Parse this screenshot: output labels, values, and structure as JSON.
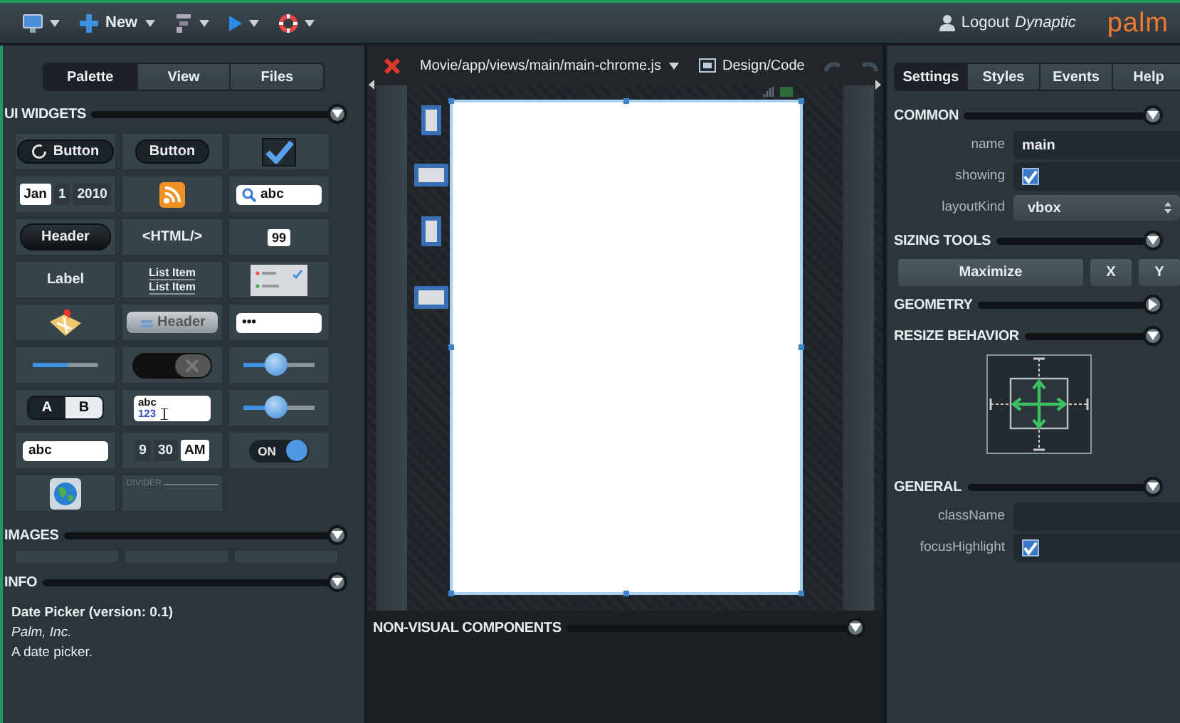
{
  "toolbar": {
    "items": [
      {
        "kind": "monitor"
      },
      {
        "kind": "new",
        "label": "New"
      },
      {
        "kind": "tools"
      },
      {
        "kind": "run"
      },
      {
        "kind": "lifebuoy"
      }
    ],
    "logout": {
      "label": "Logout",
      "user": "Dynaptic"
    },
    "logo": "palm"
  },
  "left_panel": {
    "tabs": [
      {
        "label": "Palette",
        "selected": true
      },
      {
        "label": "View",
        "selected": false
      },
      {
        "label": "Files",
        "selected": false
      }
    ],
    "widgets_section": {
      "title": "UI WIDGETS",
      "expanded": true
    },
    "widgets": [
      {
        "kind": "spinner-button",
        "label": "Button"
      },
      {
        "kind": "button",
        "label": "Button"
      },
      {
        "kind": "checkbox",
        "checked": true
      },
      {
        "kind": "date",
        "parts": [
          {
            "label": "Jan",
            "selected": true
          },
          {
            "label": "1",
            "selected": false
          },
          {
            "label": "2010",
            "selected": false
          }
        ]
      },
      {
        "kind": "feed"
      },
      {
        "kind": "search",
        "value": "abc"
      },
      {
        "kind": "header-button",
        "label": "Header"
      },
      {
        "kind": "text",
        "label": "<HTML/>"
      },
      {
        "kind": "number",
        "value": "99"
      },
      {
        "kind": "text",
        "label": "Label"
      },
      {
        "kind": "list",
        "items": [
          "List Item",
          "List Item"
        ]
      },
      {
        "kind": "menu-preview"
      },
      {
        "kind": "map"
      },
      {
        "kind": "toolbar-header",
        "label": "Header"
      },
      {
        "kind": "password",
        "value": "•••"
      },
      {
        "kind": "progress",
        "level": 0.55
      },
      {
        "kind": "delete-toggle"
      },
      {
        "kind": "slider",
        "level": 0.45
      },
      {
        "kind": "segmented",
        "options": [
          {
            "label": "A",
            "selected": true
          },
          {
            "label": "B",
            "selected": false
          }
        ]
      },
      {
        "kind": "rich-text",
        "lines": [
          "abc",
          "123"
        ]
      },
      {
        "kind": "slider",
        "level": 0.45
      },
      {
        "kind": "input",
        "value": "abc"
      },
      {
        "kind": "time",
        "parts": [
          {
            "label": "9",
            "selected": false
          },
          {
            "label": "30",
            "selected": false
          },
          {
            "label": "AM",
            "selected": true
          }
        ]
      },
      {
        "kind": "switch",
        "label": "ON",
        "on": true
      },
      {
        "kind": "globe"
      },
      {
        "kind": "divider",
        "label": "DIVIDER"
      }
    ],
    "images_section": {
      "title": "IMAGES",
      "expanded": true
    },
    "info_section": {
      "title": "INFO",
      "expanded": true
    },
    "info": {
      "title": "Date Picker (version: 0.1)",
      "vendor": "Palm, Inc.",
      "description": "A date picker."
    }
  },
  "editor": {
    "file": "Movie/app/views/main/main-chrome.js",
    "mode": "Design/Code",
    "nonvisual_section": {
      "title": "NON-VISUAL COMPONENTS",
      "expanded": true
    }
  },
  "inspector": {
    "tabs": [
      {
        "label": "Settings",
        "selected": true
      },
      {
        "label": "Styles",
        "selected": false
      },
      {
        "label": "Events",
        "selected": false
      },
      {
        "label": "Help",
        "selected": false
      }
    ],
    "sections": [
      {
        "kind": "properties",
        "title": "COMMON",
        "expanded": true,
        "fields": [
          {
            "kind": "text",
            "label": "name",
            "value": "main"
          },
          {
            "kind": "checkbox",
            "label": "showing",
            "checked": true
          },
          {
            "kind": "select",
            "label": "layoutKind",
            "value": "vbox"
          }
        ]
      },
      {
        "kind": "buttons",
        "title": "SIZING TOOLS",
        "expanded": true,
        "buttons": [
          "Maximize",
          "X",
          "Y"
        ]
      },
      {
        "kind": "properties",
        "title": "GEOMETRY",
        "expanded": false
      },
      {
        "kind": "resize",
        "title": "RESIZE BEHAVIOR",
        "expanded": true
      },
      {
        "kind": "properties",
        "title": "GENERAL",
        "expanded": true,
        "fields": [
          {
            "kind": "text",
            "label": "className"
          },
          {
            "kind": "checkbox",
            "label": "focusHighlight",
            "checked": true
          }
        ]
      }
    ]
  }
}
